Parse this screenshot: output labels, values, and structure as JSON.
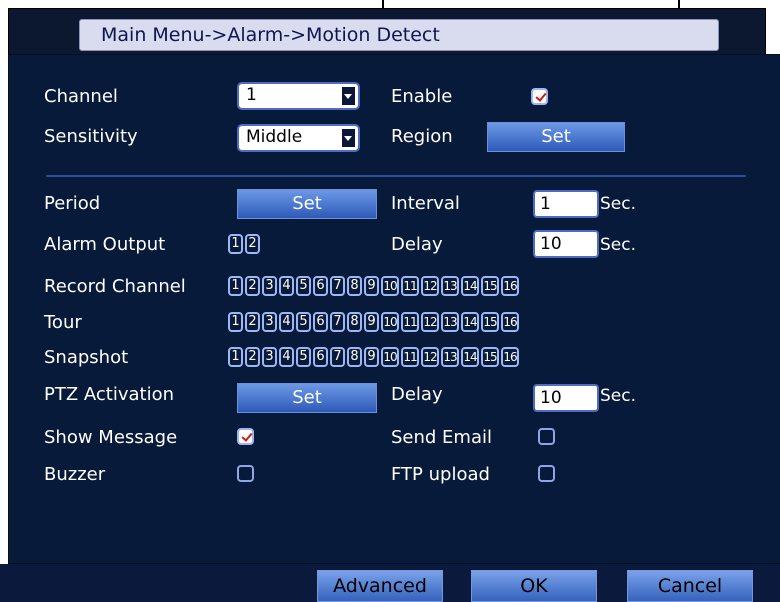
{
  "title": "Main Menu->Alarm->Motion Detect",
  "channel": {
    "label": "Channel",
    "value": "1"
  },
  "enable": {
    "label": "Enable",
    "checked": true
  },
  "sensitivity": {
    "label": "Sensitivity",
    "value": "Middle"
  },
  "region": {
    "label": "Region",
    "button": "Set"
  },
  "period": {
    "label": "Period",
    "button": "Set"
  },
  "interval": {
    "label": "Interval",
    "value": "1",
    "unit": "Sec."
  },
  "alarm_output": {
    "label": "Alarm Output",
    "channels": [
      "1",
      "2"
    ]
  },
  "delay1": {
    "label": "Delay",
    "value": "10",
    "unit": "Sec."
  },
  "record_channel": {
    "label": "Record Channel",
    "channels": [
      "1",
      "2",
      "3",
      "4",
      "5",
      "6",
      "7",
      "8",
      "9",
      "10",
      "11",
      "12",
      "13",
      "14",
      "15",
      "16"
    ]
  },
  "tour": {
    "label": "Tour",
    "channels": [
      "1",
      "2",
      "3",
      "4",
      "5",
      "6",
      "7",
      "8",
      "9",
      "10",
      "11",
      "12",
      "13",
      "14",
      "15",
      "16"
    ]
  },
  "snapshot": {
    "label": "Snapshot",
    "channels": [
      "1",
      "2",
      "3",
      "4",
      "5",
      "6",
      "7",
      "8",
      "9",
      "10",
      "11",
      "12",
      "13",
      "14",
      "15",
      "16"
    ]
  },
  "ptz_activation": {
    "label": "PTZ Activation",
    "button": "Set"
  },
  "delay2": {
    "label": "Delay",
    "value": "10",
    "unit": "Sec."
  },
  "show_message": {
    "label": "Show Message",
    "checked": true
  },
  "send_email": {
    "label": "Send Email",
    "checked": false
  },
  "buzzer": {
    "label": "Buzzer",
    "checked": false
  },
  "ftp_upload": {
    "label": "FTP upload",
    "checked": false
  },
  "footer": {
    "advanced": "Advanced",
    "ok": "OK",
    "cancel": "Cancel"
  },
  "colors": {
    "panel": "#081a39",
    "button": "#4a78d6",
    "check": "#d21616"
  }
}
